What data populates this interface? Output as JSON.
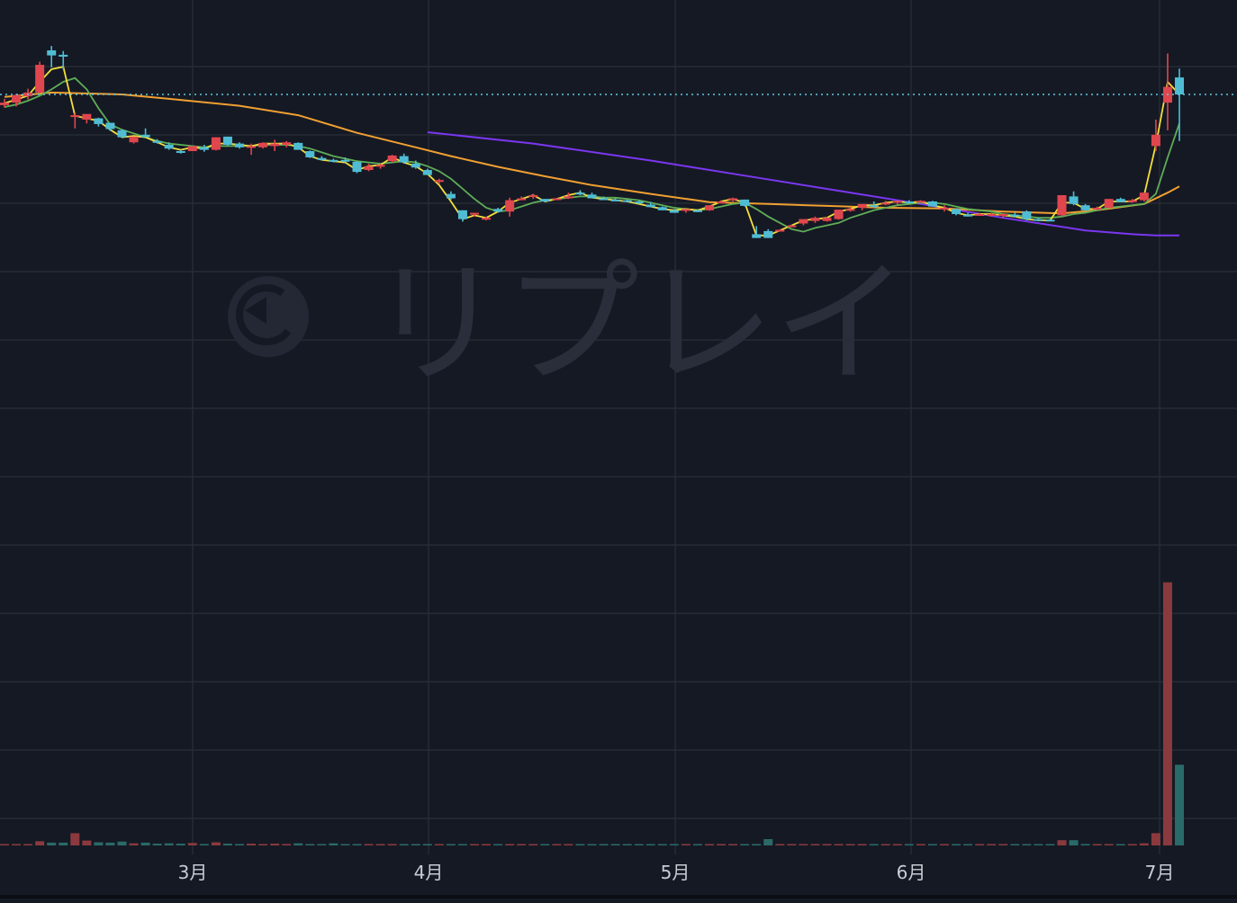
{
  "colors": {
    "background": "#151924",
    "grid": "#2a2e39",
    "up": "#e0464e",
    "down": "#4fbcd4",
    "ma_short": "#f2df3d",
    "ma_mid": "#5fae57",
    "ma_long": "#f0a031",
    "ma_longest": "#7a37f0",
    "price_line": "#5fc8e0",
    "vol_up": "#8a3a3e",
    "vol_down": "#2a6a68"
  },
  "watermark": {
    "text": "リプレイ"
  },
  "chart_data": {
    "type": "candlestick",
    "x_axis_labels": [
      "3月",
      "4月",
      "5月",
      "6月",
      "7月"
    ],
    "last_price": 100,
    "ohlc": [
      {
        "o": 91.5,
        "h": 96.5,
        "l": 89.5,
        "c": 93.5
      },
      {
        "o": 93.5,
        "h": 100.5,
        "l": 90.5,
        "c": 99.5
      },
      {
        "o": 98.5,
        "h": 104.5,
        "l": 96,
        "c": 101.5
      },
      {
        "o": 101.5,
        "h": 126,
        "l": 101,
        "c": 123.5
      },
      {
        "o": 135,
        "h": 138.5,
        "l": 121.5,
        "c": 131
      },
      {
        "o": 131.5,
        "h": 134.5,
        "l": 120,
        "c": 130
      },
      {
        "o": 83.5,
        "h": 85.5,
        "l": 73,
        "c": 83.5
      },
      {
        "o": 80,
        "h": 82.5,
        "l": 77,
        "c": 84.5
      },
      {
        "o": 81,
        "h": 81.5,
        "l": 74.5,
        "c": 76.5
      },
      {
        "o": 77.5,
        "h": 77.5,
        "l": 71,
        "c": 72.5
      },
      {
        "o": 71.5,
        "h": 72.5,
        "l": 66,
        "c": 66
      },
      {
        "o": 62,
        "h": 66.5,
        "l": 61,
        "c": 66.5
      },
      {
        "o": 68,
        "h": 73,
        "l": 66.5,
        "c": 66
      },
      {
        "o": 63,
        "h": 64.5,
        "l": 61,
        "c": 62
      },
      {
        "o": 60,
        "h": 62,
        "l": 56,
        "c": 57
      },
      {
        "o": 55,
        "h": 56,
        "l": 53,
        "c": 54
      },
      {
        "o": 55,
        "h": 59,
        "l": 56,
        "c": 59
      },
      {
        "o": 58,
        "h": 60,
        "l": 54.5,
        "c": 56
      },
      {
        "o": 56,
        "h": 66,
        "l": 55.5,
        "c": 66
      },
      {
        "o": 66.5,
        "h": 66.5,
        "l": 59,
        "c": 60
      },
      {
        "o": 61,
        "h": 62,
        "l": 57,
        "c": 58
      },
      {
        "o": 59,
        "h": 61,
        "l": 52,
        "c": 59
      },
      {
        "o": 58,
        "h": 62,
        "l": 57,
        "c": 61.5
      },
      {
        "o": 59,
        "h": 64,
        "l": 55,
        "c": 61
      },
      {
        "o": 60,
        "h": 63,
        "l": 58,
        "c": 62
      },
      {
        "o": 61.5,
        "h": 62,
        "l": 57,
        "c": 56
      },
      {
        "o": 55,
        "h": 55.5,
        "l": 49.5,
        "c": 50
      },
      {
        "o": 49.5,
        "h": 51,
        "l": 47.5,
        "c": 48
      },
      {
        "o": 48,
        "h": 49,
        "l": 46,
        "c": 47
      },
      {
        "o": 48,
        "h": 50,
        "l": 46,
        "c": 47.5
      },
      {
        "o": 46.5,
        "h": 47,
        "l": 37.5,
        "c": 38.5
      },
      {
        "o": 40,
        "h": 45,
        "l": 39,
        "c": 43
      },
      {
        "o": 43,
        "h": 45,
        "l": 41,
        "c": 44
      },
      {
        "o": 47,
        "h": 52,
        "l": 46,
        "c": 51.5
      },
      {
        "o": 51,
        "h": 53,
        "l": 45,
        "c": 46
      },
      {
        "o": 45,
        "h": 47.5,
        "l": 41,
        "c": 42
      },
      {
        "o": 40,
        "h": 41,
        "l": 36,
        "c": 36
      },
      {
        "o": 31,
        "h": 33,
        "l": 29,
        "c": 32
      },
      {
        "o": 21,
        "h": 23,
        "l": 16.5,
        "c": 17.5
      },
      {
        "o": 8,
        "h": 8,
        "l": -1,
        "c": 1
      },
      {
        "o": 5,
        "h": 6,
        "l": 3,
        "c": 6
      },
      {
        "o": 2,
        "h": 3,
        "l": 0,
        "c": 2
      },
      {
        "o": 9,
        "h": 10,
        "l": 6,
        "c": 7
      },
      {
        "o": 7,
        "h": 18,
        "l": 3,
        "c": 16
      },
      {
        "o": 16,
        "h": 19,
        "l": 16,
        "c": 17.5
      },
      {
        "o": 19,
        "h": 21,
        "l": 17,
        "c": 20
      },
      {
        "o": 17,
        "h": 17,
        "l": 14.5,
        "c": 15
      },
      {
        "o": 17,
        "h": 17.5,
        "l": 16.5,
        "c": 17.5
      },
      {
        "o": 17.5,
        "h": 22,
        "l": 17,
        "c": 19
      },
      {
        "o": 22,
        "h": 24,
        "l": 20,
        "c": 21.5
      },
      {
        "o": 20.5,
        "h": 22,
        "l": 17.5,
        "c": 17.5
      },
      {
        "o": 17.5,
        "h": 19,
        "l": 16.5,
        "c": 17
      },
      {
        "o": 16.5,
        "h": 17.5,
        "l": 15.5,
        "c": 16
      },
      {
        "o": 16,
        "h": 16.5,
        "l": 15,
        "c": 15
      },
      {
        "o": 15,
        "h": 15.5,
        "l": 13,
        "c": 13.5
      },
      {
        "o": 12.5,
        "h": 14.5,
        "l": 10.5,
        "c": 10.5
      },
      {
        "o": 10.5,
        "h": 11,
        "l": 8,
        "c": 8
      },
      {
        "o": 8,
        "h": 9,
        "l": 6,
        "c": 6
      },
      {
        "o": 7.5,
        "h": 9,
        "l": 6,
        "c": 9
      },
      {
        "o": 8,
        "h": 9,
        "l": 6.5,
        "c": 7.5
      },
      {
        "o": 8,
        "h": 12,
        "l": 7.5,
        "c": 12
      },
      {
        "o": 14,
        "h": 16,
        "l": 13.5,
        "c": 15
      },
      {
        "o": 16,
        "h": 18,
        "l": 15,
        "c": 17.5
      },
      {
        "o": 16.5,
        "h": 16.5,
        "l": 11,
        "c": 11.5
      },
      {
        "o": -11,
        "h": -4.5,
        "l": -14,
        "c": -14
      },
      {
        "o": -8.5,
        "h": -7,
        "l": -14,
        "c": -14
      },
      {
        "o": -8,
        "h": -7,
        "l": -9,
        "c": -7.5
      },
      {
        "o": -4,
        "h": -3.5,
        "l": -5.5,
        "c": -4
      },
      {
        "o": -2.5,
        "h": -1,
        "l": -4,
        "c": 1
      },
      {
        "o": -0.5,
        "h": 3,
        "l": -2,
        "c": 2
      },
      {
        "o": -0.5,
        "h": 2.5,
        "l": -1,
        "c": 2
      },
      {
        "o": 1,
        "h": 8.5,
        "l": 0.5,
        "c": 8.5
      },
      {
        "o": 9,
        "h": 10,
        "l": 7,
        "c": 9
      },
      {
        "o": 10,
        "h": 11,
        "l": 8,
        "c": 13
      },
      {
        "o": 12,
        "h": 15,
        "l": 10,
        "c": 11.5
      },
      {
        "o": 13,
        "h": 15.5,
        "l": 12,
        "c": 14
      },
      {
        "o": 14,
        "h": 15.5,
        "l": 12.5,
        "c": 15.5
      },
      {
        "o": 15,
        "h": 16,
        "l": 13.5,
        "c": 13.5
      },
      {
        "o": 15,
        "h": 16,
        "l": 14.5,
        "c": 15.5
      },
      {
        "o": 15,
        "h": 15.5,
        "l": 11,
        "c": 11
      },
      {
        "o": 10,
        "h": 12,
        "l": 7,
        "c": 10
      },
      {
        "o": 9,
        "h": 9.5,
        "l": 4,
        "c": 5
      },
      {
        "o": 4.5,
        "h": 6,
        "l": 3,
        "c": 3.5
      },
      {
        "o": 4.5,
        "h": 6,
        "l": 3.5,
        "c": 5
      },
      {
        "o": 4.5,
        "h": 6,
        "l": 3,
        "c": 5
      },
      {
        "o": 4.5,
        "h": 5.5,
        "l": 2,
        "c": 5
      },
      {
        "o": 4.5,
        "h": 6,
        "l": 2.5,
        "c": 4
      },
      {
        "o": 7,
        "h": 8,
        "l": 0,
        "c": 1
      },
      {
        "o": 1,
        "h": 2,
        "l": -0.5,
        "c": 0
      },
      {
        "o": 0.5,
        "h": 1,
        "l": 0,
        "c": 0
      },
      {
        "o": 4,
        "h": 20,
        "l": 3,
        "c": 20
      },
      {
        "o": 19,
        "h": 23,
        "l": 12,
        "c": 13
      },
      {
        "o": 12,
        "h": 13,
        "l": 7,
        "c": 8
      },
      {
        "o": 9,
        "h": 11,
        "l": 8,
        "c": 10
      },
      {
        "o": 10,
        "h": 17,
        "l": 9.5,
        "c": 17
      },
      {
        "o": 17,
        "h": 18,
        "l": 14.5,
        "c": 14.5
      },
      {
        "o": 15.5,
        "h": 17,
        "l": 14,
        "c": 16
      },
      {
        "o": 16,
        "h": 22,
        "l": 15,
        "c": 22
      },
      {
        "o": 59,
        "h": 80,
        "l": 55,
        "c": 68
      },
      {
        "o": 93.5,
        "h": 132.5,
        "l": 71.5,
        "c": 106
      },
      {
        "o": 113.5,
        "h": 120.5,
        "l": 63,
        "c": 100
      }
    ],
    "volume": [
      0.2,
      0.1,
      0.4,
      1.2,
      0.8,
      0.8,
      3.5,
      1.4,
      0.9,
      0.8,
      1.1,
      0.6,
      0.8,
      0.5,
      0.6,
      0.5,
      0.7,
      0.4,
      0.9,
      0.5,
      0.4,
      0.5,
      0.4,
      0.5,
      0.4,
      0.6,
      0.4,
      0.3,
      0.6,
      0.3,
      0.3,
      0.4,
      0.3,
      0.4,
      0.3,
      0.3,
      0.4,
      0.3,
      0.3,
      0.2,
      0.3,
      0.4,
      0.3,
      0.4,
      0.4,
      0.3,
      0.2,
      0.3,
      0.3,
      0.3,
      0.2,
      0.2,
      0.3,
      0.2,
      0.3,
      0.2,
      0.2,
      0.3,
      0.2,
      0.2,
      0.3,
      0.2,
      0.2,
      0.2,
      0.4,
      1.8,
      0.4,
      0.4,
      0.3,
      0.3,
      0.3,
      0.3,
      0.2,
      0.2,
      0.2,
      0.2,
      0.2,
      0.2,
      0.2,
      0.2,
      0.2,
      0.2,
      0.2,
      0.2,
      0.2,
      0.2,
      0.2,
      0.2,
      0.2,
      0.2,
      1.5,
      1.5,
      0.4,
      0.3,
      0.3,
      0.3,
      0.3,
      0.6,
      3.5,
      75,
      23
    ],
    "ma_short": [
      93,
      96,
      99,
      110,
      120,
      122,
      83,
      81,
      79,
      72,
      66,
      67,
      66,
      62,
      58,
      56,
      58,
      57,
      61,
      61,
      60,
      59,
      61,
      61,
      61,
      58,
      51,
      48,
      47,
      46,
      40,
      43,
      44,
      50,
      46,
      43,
      37,
      28,
      15,
      1,
      4,
      2,
      7,
      14,
      17,
      20,
      15,
      17,
      20,
      22,
      18,
      17,
      16,
      15,
      13,
      11,
      9,
      8,
      9,
      8,
      11,
      15,
      17,
      14,
      -12,
      -12,
      -8,
      -4,
      0,
      1,
      2,
      7,
      9,
      12,
      12,
      14,
      15,
      14,
      15,
      12,
      10,
      6,
      4,
      5,
      5,
      4,
      3,
      1,
      0,
      0,
      14,
      14,
      9,
      9,
      15,
      15,
      15,
      20,
      60,
      110,
      100
    ],
    "ma_mid": [
      90,
      92,
      95,
      99,
      104,
      110,
      113,
      104,
      89,
      76,
      72,
      69,
      66,
      63,
      61,
      60,
      59,
      58,
      59,
      59,
      59,
      59,
      60,
      60,
      60,
      59,
      57,
      54,
      51,
      49,
      47,
      46,
      45,
      46,
      47,
      46,
      43,
      39,
      33,
      25,
      17,
      10,
      7,
      8,
      11,
      14,
      16,
      17,
      18,
      19,
      19,
      18,
      18,
      17,
      16,
      14,
      12,
      10,
      9,
      8,
      9,
      11,
      13,
      14,
      9,
      3,
      -2,
      -7,
      -9,
      -6,
      -4,
      -2,
      2,
      5,
      8,
      10,
      12,
      13,
      14,
      14,
      13,
      11,
      9,
      8,
      7,
      5,
      4,
      3,
      2,
      2,
      3,
      5,
      6,
      8,
      10,
      11,
      12,
      13,
      21,
      50,
      77
    ],
    "ma_long": [
      98,
      98,
      99,
      100,
      102,
      103,
      103,
      102,
      101,
      100,
      99,
      98,
      96,
      94,
      92,
      90,
      88,
      86,
      84,
      82,
      80,
      78,
      76,
      73,
      70,
      67,
      64,
      60,
      56,
      53,
      51,
      49,
      47,
      45,
      42,
      38,
      34,
      30,
      26,
      22,
      19,
      16,
      14,
      12,
      10,
      8,
      6,
      4,
      2,
      1,
      0,
      0,
      0,
      0,
      0,
      0,
      0,
      0,
      0,
      0,
      0,
      0,
      0,
      0,
      0,
      0,
      0,
      0,
      0,
      0,
      0,
      0,
      0,
      0,
      0,
      0,
      0,
      0,
      0,
      0,
      0,
      0,
      0,
      0,
      0,
      0,
      0,
      0,
      0,
      0,
      0,
      0,
      0,
      0,
      0,
      0,
      0,
      0,
      0,
      0,
      0
    ],
    "ma_long_tail": [
      {
        "i": 0,
        "v": 98
      },
      {
        "i": 4,
        "v": 101.5
      },
      {
        "i": 10,
        "v": 100
      },
      {
        "i": 14,
        "v": 96.5
      },
      {
        "i": 20,
        "v": 91
      },
      {
        "i": 25,
        "v": 83.5
      },
      {
        "i": 30,
        "v": 69.5
      },
      {
        "i": 35,
        "v": 58
      },
      {
        "i": 38,
        "v": 51
      },
      {
        "i": 42,
        "v": 42.5
      },
      {
        "i": 46,
        "v": 35
      },
      {
        "i": 50,
        "v": 28
      },
      {
        "i": 55,
        "v": 21
      },
      {
        "i": 60,
        "v": 14.5
      },
      {
        "i": 65,
        "v": 13
      },
      {
        "i": 70,
        "v": 11.5
      },
      {
        "i": 75,
        "v": 10
      },
      {
        "i": 80,
        "v": 9.5
      },
      {
        "i": 85,
        "v": 7
      },
      {
        "i": 90,
        "v": 5.5
      },
      {
        "i": 93,
        "v": 8
      },
      {
        "i": 97,
        "v": 13
      },
      {
        "i": 99,
        "v": 22
      },
      {
        "i": 100,
        "v": 27
      }
    ],
    "ma_longest": [
      {
        "i": 36,
        "v": 70
      },
      {
        "i": 45,
        "v": 61
      },
      {
        "i": 55,
        "v": 47.5
      },
      {
        "i": 62,
        "v": 37
      },
      {
        "i": 70,
        "v": 25
      },
      {
        "i": 78,
        "v": 13
      },
      {
        "i": 85,
        "v": 2
      },
      {
        "i": 92,
        "v": -8
      },
      {
        "i": 96,
        "v": -11
      },
      {
        "i": 98,
        "v": -12
      },
      {
        "i": 100,
        "v": -12
      }
    ]
  }
}
